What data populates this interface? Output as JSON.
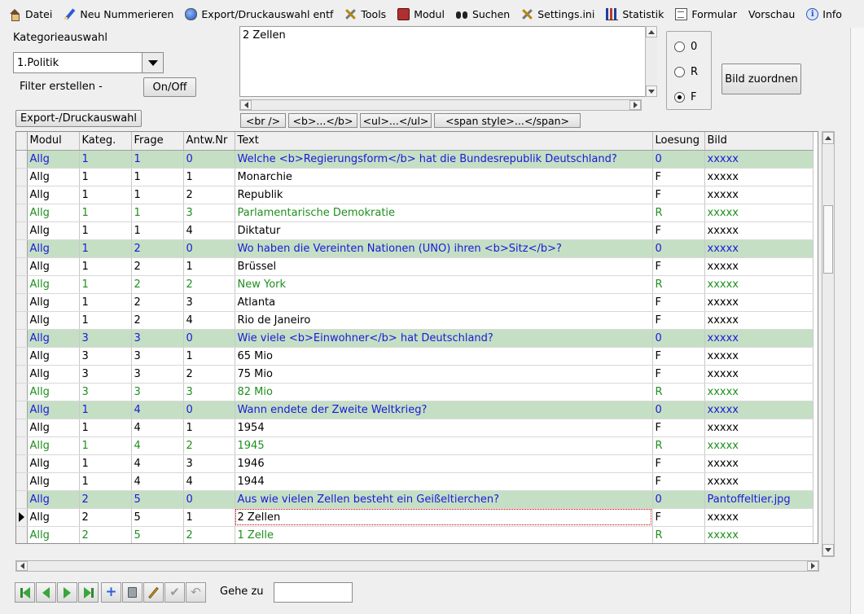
{
  "menu": [
    {
      "label": "Datei",
      "icon": "home-icon"
    },
    {
      "label": "Neu Nummerieren",
      "icon": "pen-icon"
    },
    {
      "label": "Export/Druckauswahl entf",
      "icon": "globe-icon"
    },
    {
      "label": "Tools",
      "icon": "tools-icon"
    },
    {
      "label": "Modul",
      "icon": "book-icon"
    },
    {
      "label": "Suchen",
      "icon": "binoculars-icon"
    },
    {
      "label": "Settings.ini",
      "icon": "tools-icon"
    },
    {
      "label": "Statistik",
      "icon": "statistics-icon"
    },
    {
      "label": "Formular",
      "icon": "document-icon"
    },
    {
      "label": "Vorschau",
      "icon": ""
    },
    {
      "label": "Info",
      "icon": "info-icon"
    }
  ],
  "left": {
    "category_label": "Kategorieauswahl",
    "category_value": "1.Politik",
    "filter_label": "Filter erstellen -",
    "onoff_button": "On/Off",
    "export_button": "Export-/Druckauswahl"
  },
  "memo": {
    "text": "2 Zellen"
  },
  "tag_buttons": [
    "<br />",
    "<b>...</b>",
    "<ul>...</ul>",
    "<span style>...</span>"
  ],
  "radio": {
    "options": [
      "0",
      "R",
      "F"
    ],
    "selected": "F"
  },
  "assign_image_button": "Bild zuordnen",
  "grid": {
    "columns": [
      "Modul",
      "Kateg.",
      "Frage",
      "Antw.Nr",
      "Text",
      "Loesung",
      "Bild"
    ],
    "current_row": 20,
    "rows": [
      {
        "kind": "q",
        "cells": [
          "Allg",
          "1",
          "1",
          "0",
          "Welche <b>Regierungsform</b> hat die Bundesrepublik Deutschland?",
          "0",
          "xxxxx"
        ]
      },
      {
        "kind": "norm",
        "cells": [
          "Allg",
          "1",
          "1",
          "1",
          "Monarchie",
          "F",
          "xxxxx"
        ]
      },
      {
        "kind": "norm",
        "cells": [
          "Allg",
          "1",
          "1",
          "2",
          "Republik",
          "F",
          "xxxxx"
        ]
      },
      {
        "kind": "ok",
        "cells": [
          "Allg",
          "1",
          "1",
          "3",
          "Parlamentarische Demokratie",
          "R",
          "xxxxx"
        ]
      },
      {
        "kind": "norm",
        "cells": [
          "Allg",
          "1",
          "1",
          "4",
          "Diktatur",
          "F",
          "xxxxx"
        ]
      },
      {
        "kind": "q",
        "cells": [
          "Allg",
          "1",
          "2",
          "0",
          "Wo haben die Vereinten Nationen (UNO) ihren <b>Sitz</b>?",
          "0",
          "xxxxx"
        ]
      },
      {
        "kind": "norm",
        "cells": [
          "Allg",
          "1",
          "2",
          "1",
          "Brüssel",
          "F",
          "xxxxx"
        ]
      },
      {
        "kind": "ok",
        "cells": [
          "Allg",
          "1",
          "2",
          "2",
          "New York",
          "R",
          "xxxxx"
        ]
      },
      {
        "kind": "norm",
        "cells": [
          "Allg",
          "1",
          "2",
          "3",
          "Atlanta",
          "F",
          "xxxxx"
        ]
      },
      {
        "kind": "norm",
        "cells": [
          "Allg",
          "1",
          "2",
          "4",
          "Rio de Janeiro",
          "F",
          "xxxxx"
        ]
      },
      {
        "kind": "q",
        "cells": [
          "Allg",
          "3",
          "3",
          "0",
          "Wie viele <b>Einwohner</b> hat Deutschland?",
          "0",
          "xxxxx"
        ]
      },
      {
        "kind": "norm",
        "cells": [
          "Allg",
          "3",
          "3",
          "1",
          "65 Mio",
          "F",
          "xxxxx"
        ]
      },
      {
        "kind": "norm",
        "cells": [
          "Allg",
          "3",
          "3",
          "2",
          "75 Mio",
          "F",
          "xxxxx"
        ]
      },
      {
        "kind": "ok",
        "cells": [
          "Allg",
          "3",
          "3",
          "3",
          "82 Mio",
          "R",
          "xxxxx"
        ]
      },
      {
        "kind": "q",
        "cells": [
          "Allg",
          "1",
          "4",
          "0",
          "Wann endete der Zweite Weltkrieg?",
          "0",
          "xxxxx"
        ]
      },
      {
        "kind": "norm",
        "cells": [
          "Allg",
          "1",
          "4",
          "1",
          "1954",
          "F",
          "xxxxx"
        ]
      },
      {
        "kind": "ok",
        "cells": [
          "Allg",
          "1",
          "4",
          "2",
          "1945",
          "R",
          "xxxxx"
        ]
      },
      {
        "kind": "norm",
        "cells": [
          "Allg",
          "1",
          "4",
          "3",
          "1946",
          "F",
          "xxxxx"
        ]
      },
      {
        "kind": "norm",
        "cells": [
          "Allg",
          "1",
          "4",
          "4",
          "1944",
          "F",
          "xxxxx"
        ]
      },
      {
        "kind": "q",
        "cells": [
          "Allg",
          "2",
          "5",
          "0",
          "Aus wie vielen Zellen besteht ein Geißeltierchen?",
          "0",
          "Pantoffeltier.jpg"
        ]
      },
      {
        "kind": "norm",
        "cells": [
          "Allg",
          "2",
          "5",
          "1",
          "2 Zellen",
          "F",
          "xxxxx"
        ]
      },
      {
        "kind": "ok",
        "cells": [
          "Allg",
          "2",
          "5",
          "2",
          "1 Zelle",
          "R",
          "xxxxx"
        ]
      }
    ]
  },
  "nav": {
    "goto_label": "Gehe zu",
    "goto_value": ""
  },
  "colors": {
    "question_row_bg": "#c5dfc5",
    "question_text": "#1a1ad8",
    "correct_text": "#1e8f1e"
  }
}
